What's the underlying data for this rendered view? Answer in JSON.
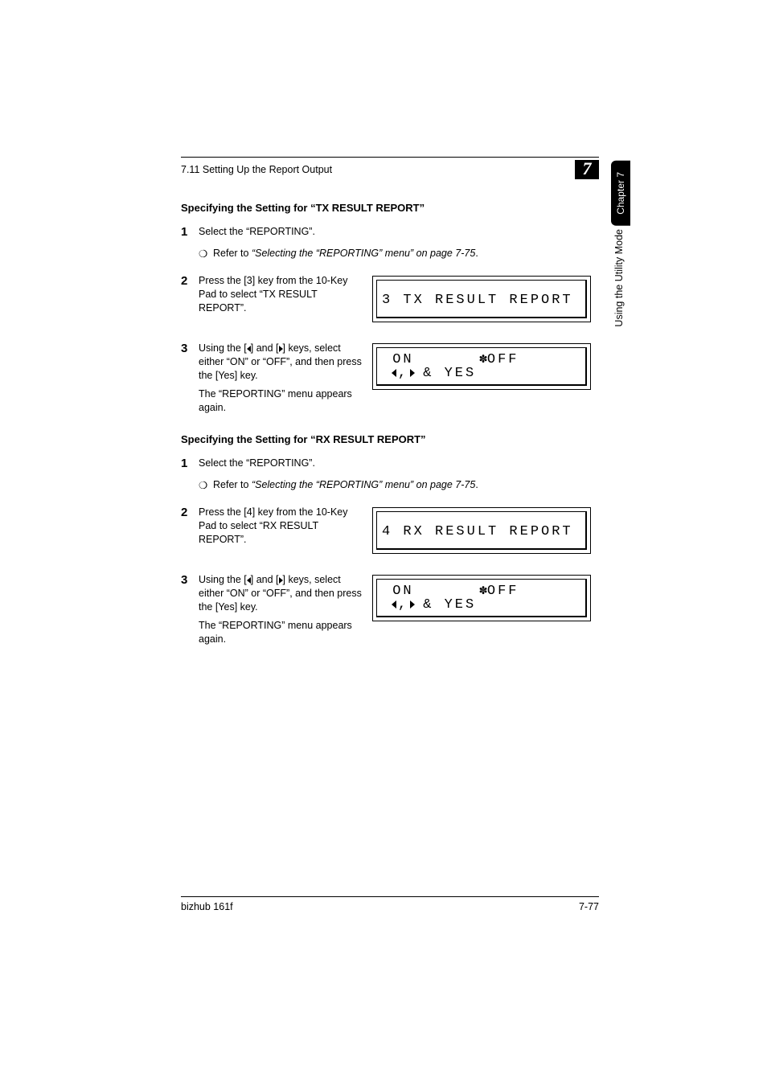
{
  "header": {
    "section": "7.11 Setting Up the Report Output",
    "chapter_num": "7"
  },
  "sidetab": {
    "black": "Chapter 7",
    "white": "Using the Utility Mode"
  },
  "tx": {
    "heading": "Specifying the Setting for “TX RESULT REPORT”",
    "step1": "Select the “REPORTING”.",
    "step1_sub_prefix": "Refer to ",
    "step1_sub_italic": "“Selecting the “REPORTING” menu” on page 7-75",
    "step1_sub_suffix": ".",
    "step2": "Press the [3] key from the 10-Key Pad to select “TX RESULT REPORT”.",
    "lcd2": "3 TX RESULT REPORT",
    "step3_a": "Using the [",
    "step3_b": "] and [",
    "step3_c": "] keys, select either “ON” or “OFF”, and then press the [Yes] key.",
    "step3_after": "The “REPORTING” menu appears again.",
    "lcd3_on": " ON",
    "lcd3_off": "OFF",
    "lcd3_yes": "& YES"
  },
  "rx": {
    "heading": "Specifying the Setting for “RX RESULT REPORT”",
    "step1": "Select the “REPORTING”.",
    "step1_sub_prefix": "Refer to ",
    "step1_sub_italic": "“Selecting the “REPORTING” menu” on page 7-75",
    "step1_sub_suffix": ".",
    "step2": "Press the [4] key from the 10-Key Pad to select “RX RESULT REPORT”.",
    "lcd2": "4 RX RESULT REPORT",
    "step3_a": "Using the [",
    "step3_b": "] and [",
    "step3_c": "] keys, select either “ON” or “OFF”, and then press the [Yes] key.",
    "step3_after": "The “REPORTING” menu appears again.",
    "lcd3_on": " ON",
    "lcd3_off": "OFF",
    "lcd3_yes": "& YES"
  },
  "footer": {
    "left": "bizhub 161f",
    "right": "7-77"
  },
  "nums": {
    "n1": "1",
    "n2": "2",
    "n3": "3"
  },
  "bullet": "❍",
  "comma": ",",
  "star": "✽"
}
